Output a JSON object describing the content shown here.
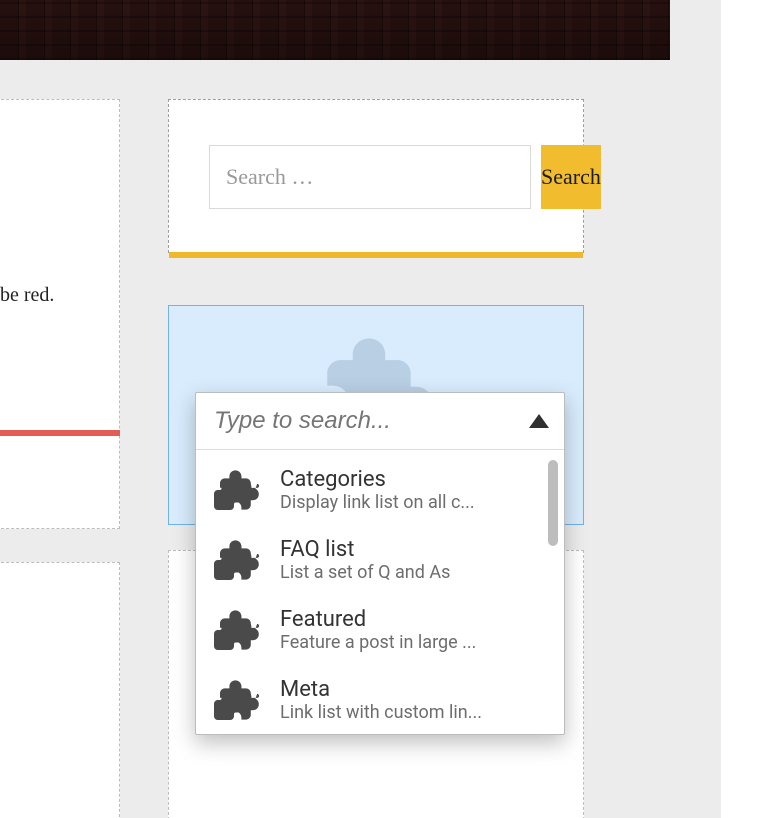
{
  "header": {
    "image_alt": "brick-building-facade"
  },
  "search_widget": {
    "placeholder": "Search …",
    "button_label": "Search"
  },
  "left_fragment": {
    "text": "be red."
  },
  "widget_picker": {
    "search_placeholder": "Type to search...",
    "items": [
      {
        "icon": "puzzle-icon",
        "title": "Categories",
        "desc": "Display link list on all c..."
      },
      {
        "icon": "puzzle-icon",
        "title": "FAQ list",
        "desc": "List a set of Q and As"
      },
      {
        "icon": "puzzle-icon",
        "title": "Featured",
        "desc": "Feature a post in large ..."
      },
      {
        "icon": "puzzle-icon",
        "title": "Meta",
        "desc": "Link list with custom lin..."
      }
    ]
  },
  "colors": {
    "accent_yellow": "#f2bc2f",
    "accent_red": "#e35d56",
    "dropzone_bg": "#d8ecfd",
    "dropzone_border": "#6fb3e8"
  }
}
